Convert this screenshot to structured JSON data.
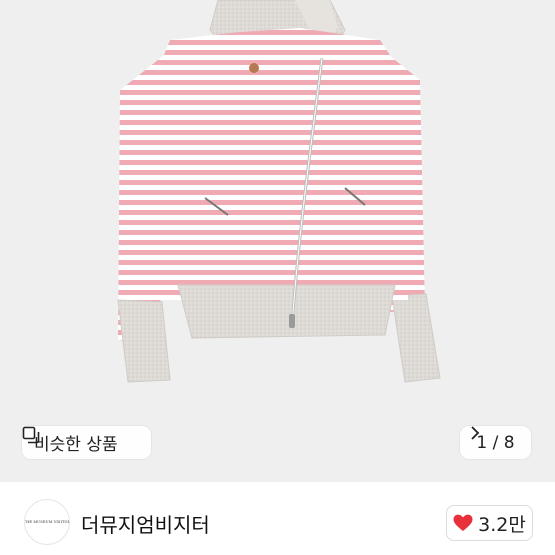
{
  "product_image": {
    "subject": "striped-zip-hoodie",
    "similar_button": {
      "label": "비슷한 상품",
      "icon": "copy-icon"
    },
    "pager": {
      "text": "1 / 8",
      "icon": "chevron-right-icon"
    }
  },
  "seller": {
    "name": "더뮤지엄비지터",
    "avatar_logo": "THE MUSEUM VISITOR"
  },
  "like": {
    "count": "3.2만",
    "icon": "heart-icon",
    "color": "#e8303a"
  },
  "colors": {
    "stripe_pink": "#f0aab3",
    "knit_grey": "#dedad6",
    "background": "#efefef"
  }
}
